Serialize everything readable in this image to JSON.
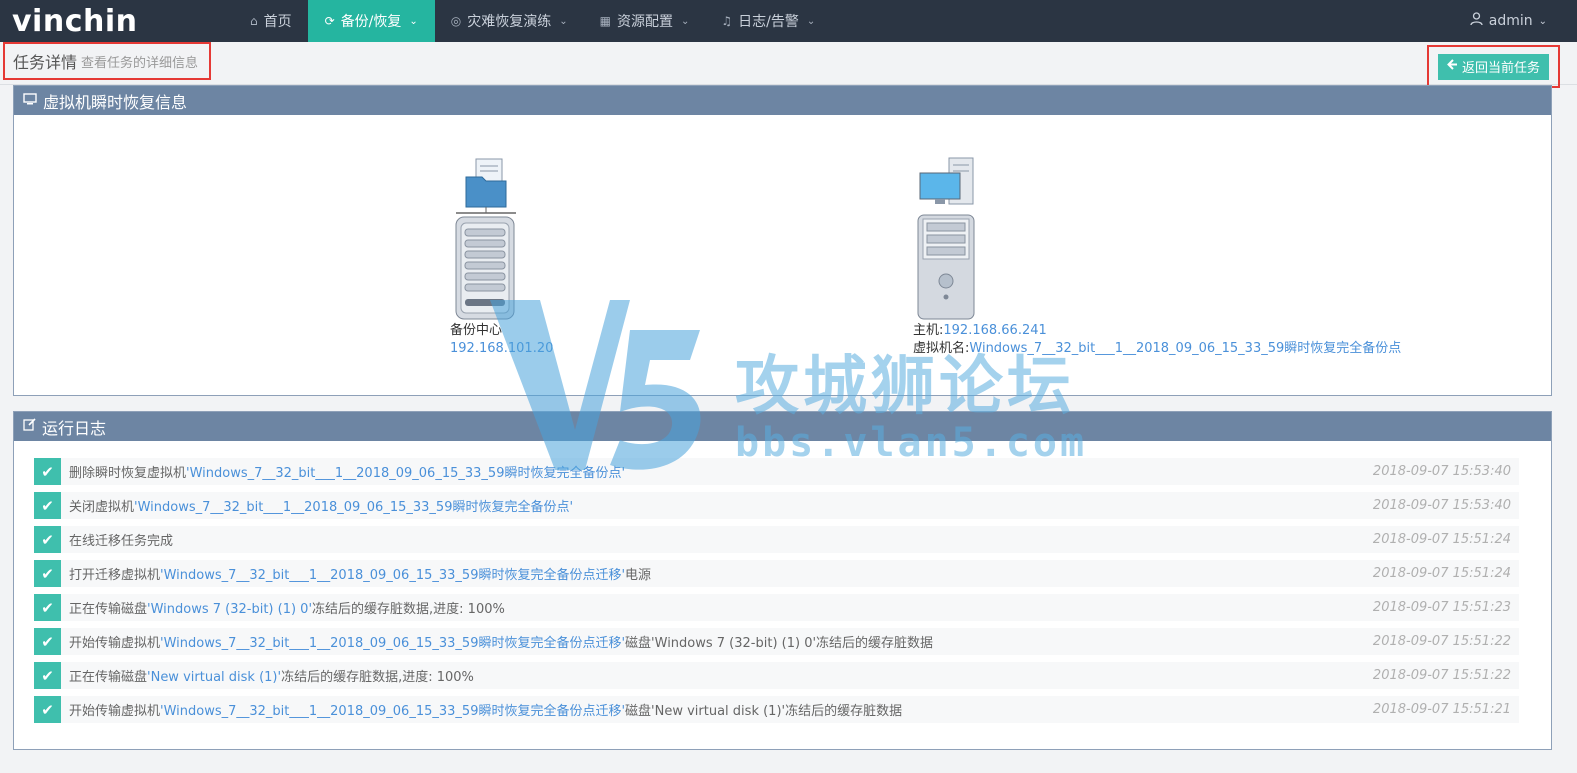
{
  "app": {
    "logo": "vinchin"
  },
  "nav": {
    "items": [
      {
        "label": "首页",
        "icon": "home-icon",
        "active": false,
        "has_dropdown": false
      },
      {
        "label": "备份/恢复",
        "icon": "refresh-icon",
        "active": true,
        "has_dropdown": true
      },
      {
        "label": "灾难恢复演练",
        "icon": "target-icon",
        "active": false,
        "has_dropdown": true
      },
      {
        "label": "资源配置",
        "icon": "grid-icon",
        "active": false,
        "has_dropdown": true
      },
      {
        "label": "日志/告警",
        "icon": "bell-icon",
        "active": false,
        "has_dropdown": true
      }
    ],
    "user": "admin"
  },
  "subheader": {
    "title": "任务详情",
    "subtitle": "查看任务的详细信息",
    "back_button": "返回当前任务"
  },
  "info_panel": {
    "title": "虚拟机瞬时恢复信息",
    "backup_center": {
      "label": "备份中心",
      "ip": "192.168.101.20"
    },
    "host": {
      "host_label": "主机:",
      "host_ip": "192.168.66.241",
      "vm_label": "虚拟机名:",
      "vm_name": "Windows_7__32_bit___1__2018_09_06_15_33_59瞬时恢复完全备份点"
    }
  },
  "log_panel": {
    "title": "运行日志",
    "entries": [
      {
        "prefix": "删除瞬时恢复虚拟机",
        "highlight": "'Windows_7__32_bit___1__2018_09_06_15_33_59瞬时恢复完全备份点'",
        "suffix": "",
        "time": "2018-09-07 15:53:40"
      },
      {
        "prefix": "关闭虚拟机",
        "highlight": "'Windows_7__32_bit___1__2018_09_06_15_33_59瞬时恢复完全备份点'",
        "suffix": "",
        "time": "2018-09-07 15:53:40"
      },
      {
        "prefix": "在线迁移任务完成",
        "highlight": "",
        "suffix": "",
        "time": "2018-09-07 15:51:24"
      },
      {
        "prefix": "打开迁移虚拟机",
        "highlight": "'Windows_7__32_bit___1__2018_09_06_15_33_59瞬时恢复完全备份点迁移'",
        "suffix": "电源",
        "time": "2018-09-07 15:51:24"
      },
      {
        "prefix": "正在传输磁盘",
        "highlight": "'Windows 7 (32-bit) (1) 0'",
        "suffix": "冻结后的缓存脏数据,进度: 100%",
        "time": "2018-09-07 15:51:23"
      },
      {
        "prefix": "开始传输虚拟机",
        "highlight": "'Windows_7__32_bit___1__2018_09_06_15_33_59瞬时恢复完全备份点迁移'",
        "suffix": "磁盘'Windows 7 (32-bit) (1) 0'冻结后的缓存脏数据",
        "time": "2018-09-07 15:51:22"
      },
      {
        "prefix": "正在传输磁盘",
        "highlight": "'New virtual disk (1)'",
        "suffix": "冻结后的缓存脏数据,进度: 100%",
        "time": "2018-09-07 15:51:22"
      },
      {
        "prefix": "开始传输虚拟机",
        "highlight": "'Windows_7__32_bit___1__2018_09_06_15_33_59瞬时恢复完全备份点迁移'",
        "suffix": "磁盘'New virtual disk (1)'冻结后的缓存脏数据",
        "time": "2018-09-07 15:51:21"
      }
    ]
  },
  "watermark": {
    "line1": "攻城狮论坛",
    "line2": "bbs.vlan5.com"
  },
  "colors": {
    "nav_bg": "#2b3543",
    "accent": "#25b5a0",
    "panel_header": "#6d85a3",
    "link": "#4a90d9",
    "highlight_border": "#e53935"
  }
}
